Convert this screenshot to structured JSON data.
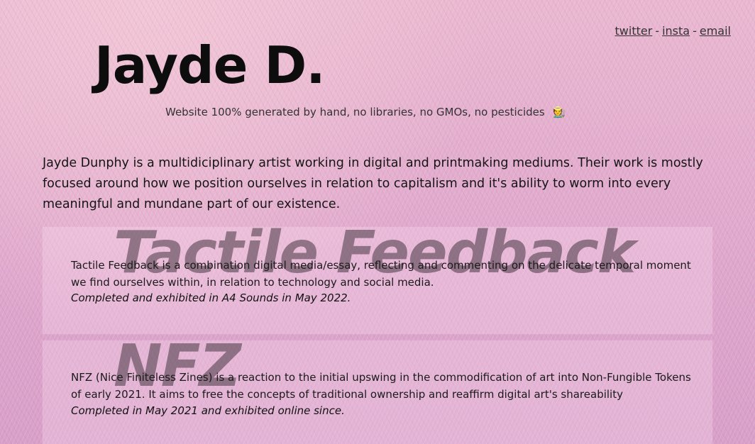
{
  "header": {
    "links": [
      {
        "label": "twitter"
      },
      {
        "label": "insta"
      },
      {
        "label": "email"
      }
    ],
    "separator": "-",
    "title": "Jayde D.",
    "tagline": "Website 100% generated by hand, no libraries, no GMOs, no pesticides",
    "tagline_emoji": "🧑‍🌾"
  },
  "bio": "Jayde Dunphy is a multidiciplinary artist working in digital and printmaking mediums. Their work is mostly focused around how we position ourselves in relation to capitalism and it's ability to worm into every meaningful and mundane part of our existence.",
  "projects": [
    {
      "title": "Tactile Feedback",
      "description": "Tactile Feedback is a combination digital media/essay, reflecting and commenting on the delicate temporal moment we find ourselves within, in relation to technology and social media.",
      "note": "Completed and exhibited in A4 Sounds in May 2022."
    },
    {
      "title": "NFZ",
      "description": "NFZ (Nice Finiteless Zines) is a reaction to the initial upswing in the commodification of art into Non-Fungible Tokens of early 2021. It aims to free the concepts of traditional ownership and reaffirm digital art's shareability",
      "note": "Completed in May 2021 and exhibited online since."
    }
  ],
  "colors": {
    "background": "#e3afd0",
    "text": "#111111",
    "watermark": "#463741"
  }
}
